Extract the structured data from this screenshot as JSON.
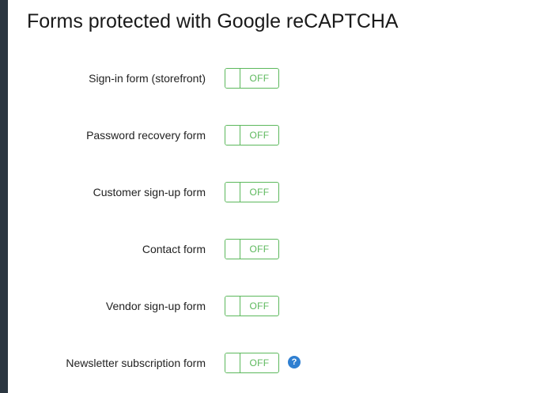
{
  "title": "Forms protected with Google reCAPTCHA",
  "forms": [
    {
      "label": "Sign-in form (storefront)",
      "state": "OFF"
    },
    {
      "label": "Password recovery form",
      "state": "OFF"
    },
    {
      "label": "Customer sign-up form",
      "state": "OFF"
    },
    {
      "label": "Contact form",
      "state": "OFF"
    },
    {
      "label": "Vendor sign-up form",
      "state": "OFF"
    },
    {
      "label": "Newsletter subscription form",
      "state": "OFF"
    }
  ],
  "help_icon": {
    "glyph": "?",
    "icon": "question-circle-icon"
  },
  "colors": {
    "toggle_accent": "#5cb85c",
    "help_icon": "#2f7fd1",
    "sidebar": "#2b3640"
  }
}
